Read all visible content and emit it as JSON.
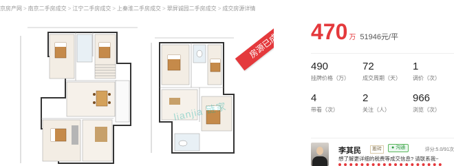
{
  "breadcrumb": {
    "items": [
      "京房产网",
      "南京二手房成交",
      "江宁二手房成交",
      "上秦淮二手房成交",
      "翠屏诚园二手房成交",
      "成交房源详情"
    ]
  },
  "plan": {
    "ribbon_text": "房源已成交",
    "watermark": "lianjia 链家",
    "room_labels": [
      "卧室",
      "卧室",
      "客厅",
      "餐厅",
      "卧室",
      "卫生间",
      "卧室",
      "衣帽间",
      "卧室",
      "卫生间",
      "书房",
      "卧室",
      "卧室",
      "卧室",
      "卫生间"
    ]
  },
  "price": {
    "total": "470",
    "unit": "万",
    "per": "51946元/平"
  },
  "stats": [
    {
      "value": "490",
      "label": "挂牌价格（万）"
    },
    {
      "value": "72",
      "label": "成交周期（天）"
    },
    {
      "value": "1",
      "label": "调价（次）"
    },
    {
      "value": "4",
      "label": "带看（次）"
    },
    {
      "value": "2",
      "label": "关注（人）"
    },
    {
      "value": "966",
      "label": "浏览（次）"
    }
  ],
  "agent": {
    "name": "李其民",
    "tag": "搬砖",
    "chat_label": "沟通",
    "score": "评分:5.0/91次",
    "desc": "想了解更详细的税费等成交信息? 请联系我~"
  },
  "colors": {
    "accent": "#e4393c",
    "green": "#2e9a41"
  }
}
